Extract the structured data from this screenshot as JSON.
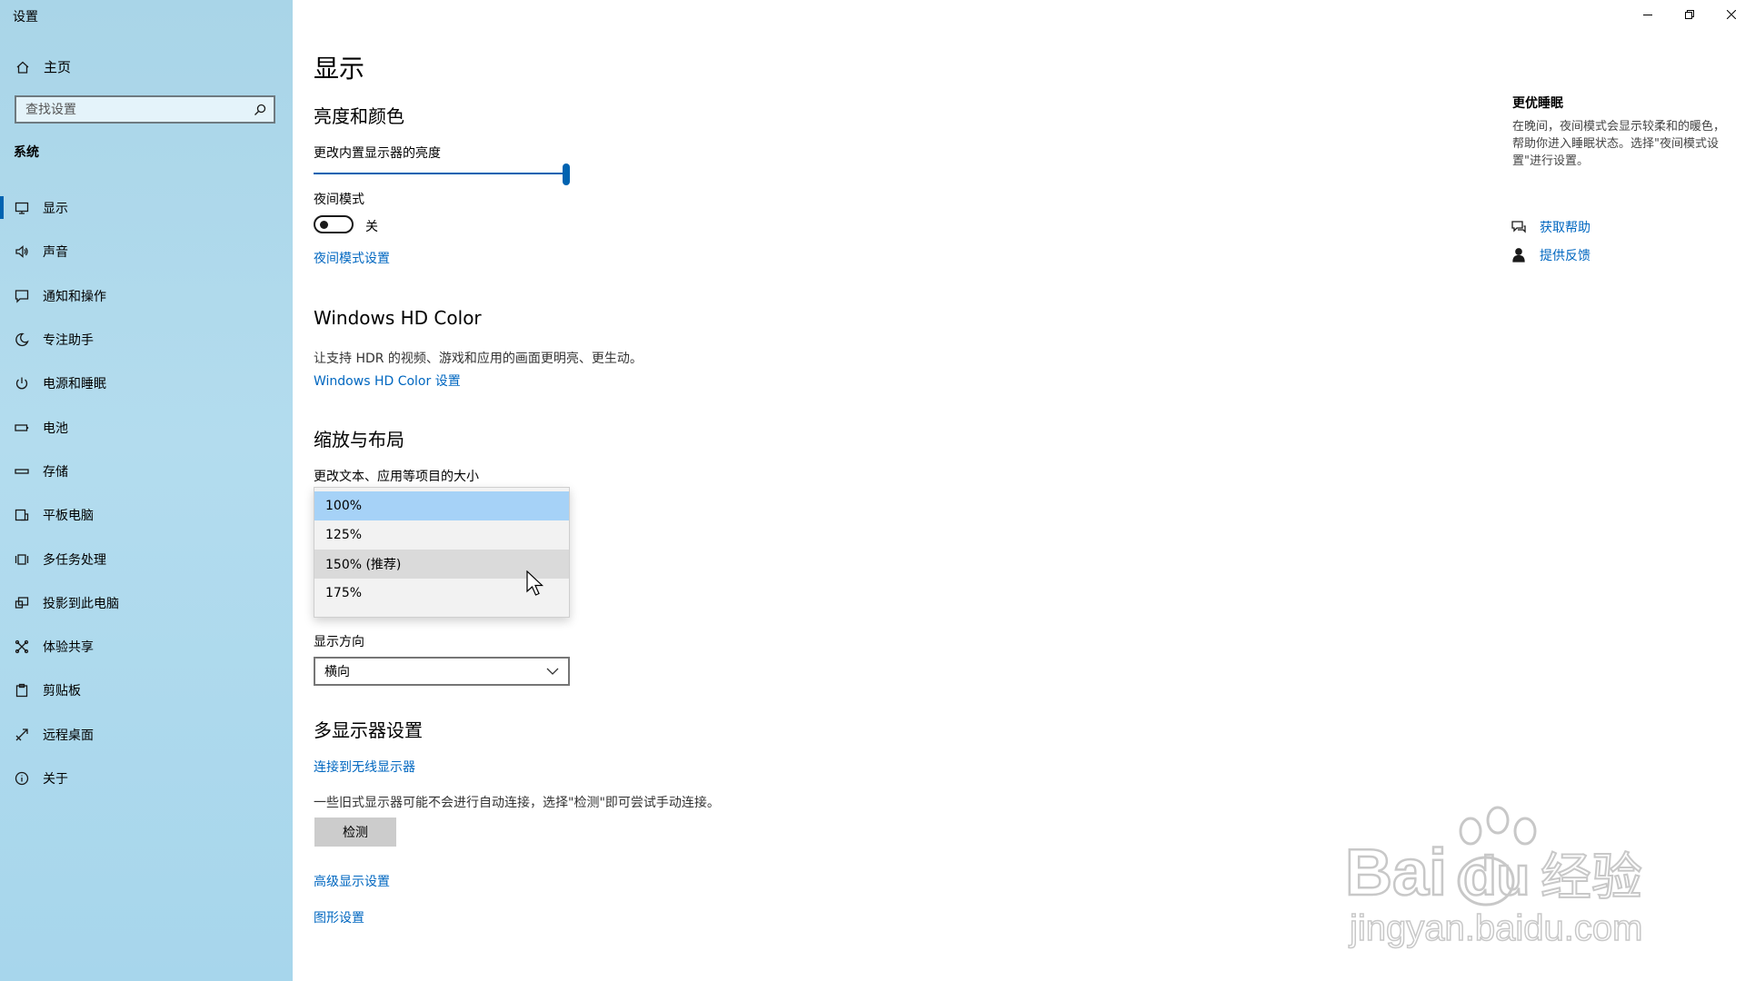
{
  "window": {
    "title": "设置",
    "minimize_icon": "minimize-icon",
    "maximize_icon": "restore-icon",
    "close_icon": "close-icon"
  },
  "sidebar": {
    "home_label": "主页",
    "search_placeholder": "查找设置",
    "section_label": "系统",
    "items": [
      {
        "label": "显示",
        "icon": "monitor-icon",
        "active": true
      },
      {
        "label": "声音",
        "icon": "speaker-icon"
      },
      {
        "label": "通知和操作",
        "icon": "notification-icon"
      },
      {
        "label": "专注助手",
        "icon": "moon-icon"
      },
      {
        "label": "电源和睡眠",
        "icon": "power-icon"
      },
      {
        "label": "电池",
        "icon": "battery-icon"
      },
      {
        "label": "存储",
        "icon": "storage-icon"
      },
      {
        "label": "平板电脑",
        "icon": "tablet-icon"
      },
      {
        "label": "多任务处理",
        "icon": "multitask-icon"
      },
      {
        "label": "投影到此电脑",
        "icon": "project-icon"
      },
      {
        "label": "体验共享",
        "icon": "share-icon"
      },
      {
        "label": "剪贴板",
        "icon": "clipboard-icon"
      },
      {
        "label": "远程桌面",
        "icon": "remote-icon"
      },
      {
        "label": "关于",
        "icon": "info-icon"
      }
    ],
    "accent_color": "#0063b1"
  },
  "main": {
    "title": "显示",
    "brightness": {
      "heading": "亮度和颜色",
      "slider_label": "更改内置显示器的亮度",
      "value_percent": 100
    },
    "night_mode": {
      "label": "夜间模式",
      "state_text": "关",
      "settings_link": "夜间模式设置"
    },
    "hdr": {
      "heading": "Windows HD Color",
      "description": "让支持 HDR 的视频、游戏和应用的画面更明亮、更生动。",
      "link": "Windows HD Color 设置"
    },
    "scale": {
      "heading": "缩放与布局",
      "label": "更改文本、应用等项目的大小",
      "options": [
        "100%",
        "125%",
        "150% (推荐)",
        "175%"
      ],
      "selected_index": 0,
      "hover_index": 2
    },
    "orientation": {
      "label": "显示方向",
      "value": "横向"
    },
    "multi_display": {
      "heading": "多显示器设置",
      "wireless_link": "连接到无线显示器",
      "description": "一些旧式显示器可能不会进行自动连接，选择\"检测\"即可尝试手动连接。",
      "detect_button": "检测",
      "advanced_link": "高级显示设置",
      "graphics_link": "图形设置"
    }
  },
  "right_panel": {
    "title": "更优睡眠",
    "description": "在晚间，夜间模式会显示较柔和的暖色，帮助你进入睡眠状态。选择\"夜间模式设置\"进行设置。",
    "help_link": "获取帮助",
    "feedback_link": "提供反馈"
  },
  "watermark": {
    "brand": "Bai",
    "brand2": "du",
    "suffix": "经验",
    "url": "jingyan.baidu.com"
  }
}
